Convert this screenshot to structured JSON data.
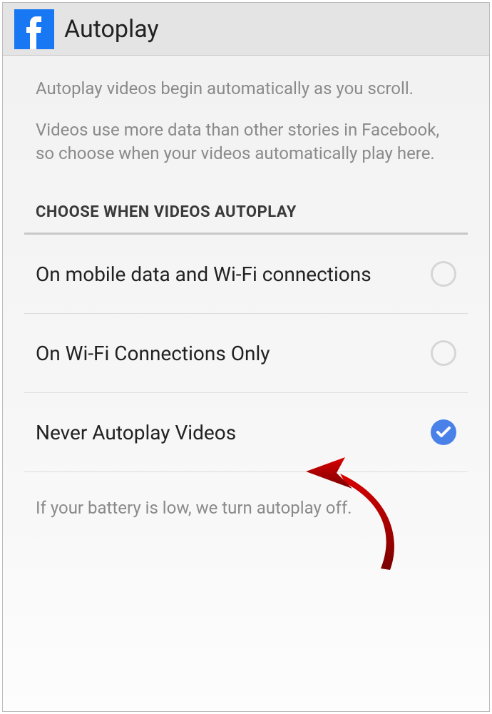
{
  "header": {
    "title": "Autoplay"
  },
  "description": {
    "line1": "Autoplay videos begin automatically as you scroll.",
    "line2": "Videos use more data than other stories in Facebook, so choose when your videos automatically play here."
  },
  "section_header": "CHOOSE WHEN VIDEOS AUTOPLAY",
  "options": [
    {
      "label": "On mobile data and Wi-Fi connections",
      "selected": false
    },
    {
      "label": "On Wi-Fi Connections Only",
      "selected": false
    },
    {
      "label": "Never Autoplay Videos",
      "selected": true
    }
  ],
  "footer_note": "If your battery is low, we turn autoplay off.",
  "colors": {
    "accent": "#4a81e8",
    "fb_blue": "#1877f2",
    "annotation_red": "#b30000"
  }
}
